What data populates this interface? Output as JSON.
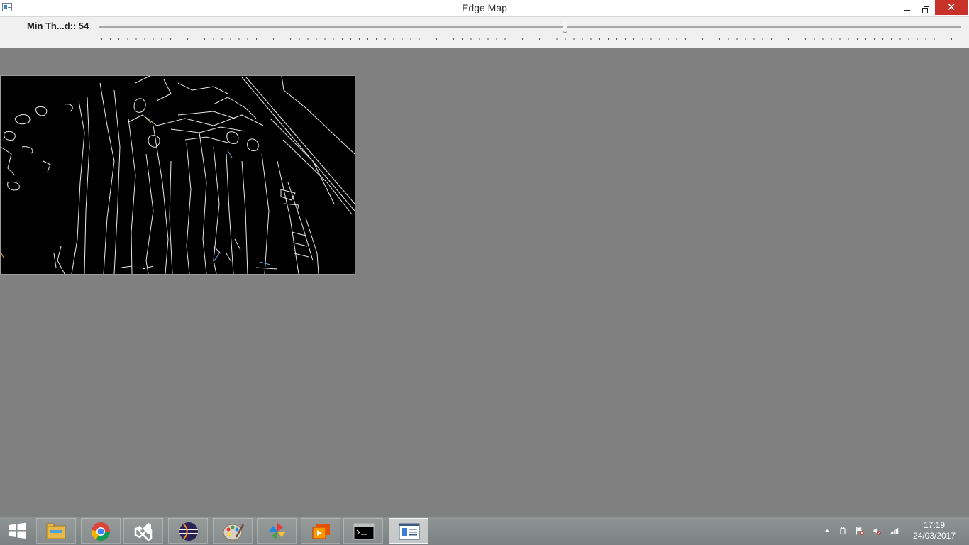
{
  "window": {
    "title": "Edge Map",
    "close_glyph": "✕"
  },
  "trackbar": {
    "label": "Min Th...d:: 54",
    "value": 54,
    "max": 100
  },
  "taskbar": {
    "apps": [
      "file-explorer-icon",
      "chrome-icon",
      "visual-studio-icon",
      "eclipse-icon",
      "paint-icon",
      "pinwheel-app-icon",
      "media-app-icon",
      "command-prompt-icon",
      "edge-map-window-icon"
    ],
    "clock_time": "17:19",
    "clock_date": "24/03/2017"
  },
  "colors": {
    "close_button": "#c7312a",
    "desktop_gray": "#808080",
    "edge_lines": "#ffffff"
  }
}
